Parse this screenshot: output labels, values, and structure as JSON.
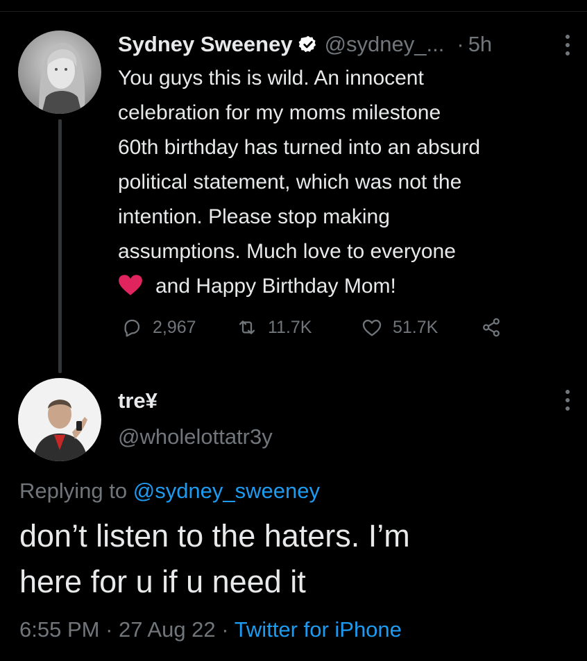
{
  "parent_tweet": {
    "author_name": "Sydney Sweeney",
    "handle": "@sydney_...",
    "separator": "·",
    "time": "5h",
    "body_lines": [
      "You guys this is wild. An innocent",
      "celebration for my moms milestone",
      "60th birthday has turned into an absurd",
      "political statement, which was not the",
      "intention. Please stop making",
      "assumptions. Much love to everyone",
      "and Happy Birthday Mom!"
    ],
    "emoji": "red-heart-icon",
    "replies": "2,967",
    "retweets": "11.7K",
    "likes": "51.7K"
  },
  "reply_tweet": {
    "author_name": "tre¥",
    "handle": "@wholelottatr3y",
    "replying_prefix": "Replying to",
    "replying_handle": "@sydney_sweeney",
    "body_lines": [
      "don’t listen to the haters. I’m",
      "here for u if u need it"
    ],
    "time": "6:55 PM",
    "sep1": "·",
    "date": "27 Aug 22",
    "sep2": "·",
    "source": "Twitter for iPhone"
  },
  "colors": {
    "background": "#000000",
    "text": "#e7e9ea",
    "secondary": "#71767b",
    "link": "#1d9bf0",
    "verified": "#ffffff",
    "heart": "#e0245e"
  }
}
